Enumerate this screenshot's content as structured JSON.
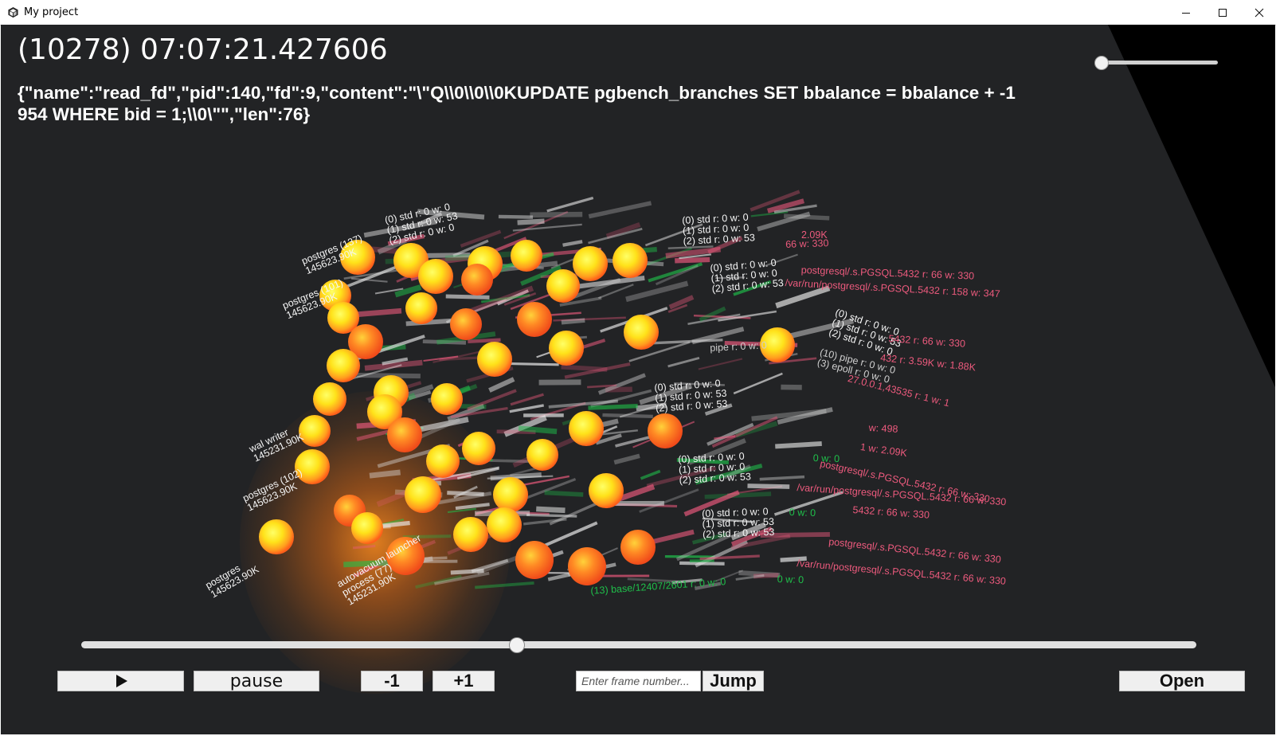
{
  "window": {
    "title": "My project",
    "icon": "unity-cube-icon"
  },
  "header": {
    "timestamp": "(10278) 07:07:21.427606",
    "event": "{\"name\":\"read_fd\",\"pid\":140,\"fd\":9,\"content\":\"\\\"Q\\\\0\\\\0\\\\0KUPDATE pgbench_branches SET bbalance = bbalance + -1954 WHERE bid = 1;\\\\0\\\"\",\"len\":76}"
  },
  "colors": {
    "background": "#222325",
    "process_label": "#f5f5f5",
    "socket_label": "#ec5a7d",
    "file_label": "#1fbf4a",
    "sphere_core": "#ffff33",
    "sphere_edge": "#ff6a1a"
  },
  "scene": {
    "process_labels": [
      {
        "name": "postgres (137)",
        "value": "145623.90K"
      },
      {
        "name": "postgres (101)",
        "value": "145623.90K"
      },
      {
        "name": "postgres (102)",
        "value": "145623.90K"
      },
      {
        "name": "wal writer",
        "value": "145231.90K"
      },
      {
        "name": "autovacuum launcher",
        "value": ""
      },
      {
        "name": "process (77)",
        "value": "145231.90K"
      },
      {
        "name": "postgres",
        "value": "145623.90K"
      }
    ],
    "fd_labels": [
      "(0) std r: 0 w: 0",
      "(1) std r: 0 w: 53",
      "(2) std r: 0 w: 0",
      "(0) std r: 0 w: 0",
      "(1) std r: 0 w: 0",
      "(2) std r: 0 w: 53"
    ],
    "socket_labels": [
      "66 w: 330",
      "/var/run/postgresql/.s.PGSQL.5432 r: 158 w: 347",
      "postgresql/.s.PGSQL.5432 r: 66 w: 330",
      "5432 r: 66 w: 330",
      "27.0.0.1,43535 r: 1 w: 1",
      "432 r: 3.59K w: 1.88K",
      "/var/run/postgresql/.s.PGSQL.5432 r: 66 w: 330",
      "postgresql/.s.PGSQL.5432 r: 66 w: 330",
      "2.09K",
      "w: 498",
      "1 w: 2.09K"
    ],
    "pipe_labels": [
      "(10) pipe r: 0 w: 0",
      "(3) epoll r: 0 w: 0",
      "pipe r: 0 w: 0"
    ],
    "file_labels": [
      "(13) base/12407/2601 r: 0 w: 0",
      "0 w: 0"
    ]
  },
  "controls": {
    "play_icon": "play-icon",
    "pause_label": "pause",
    "minus_label": "-1",
    "plus_label": "+1",
    "frame_placeholder": "Enter frame number...",
    "jump_label": "Jump",
    "open_label": "Open",
    "timeline_progress": 0.39,
    "speed_progress": 0.0
  }
}
